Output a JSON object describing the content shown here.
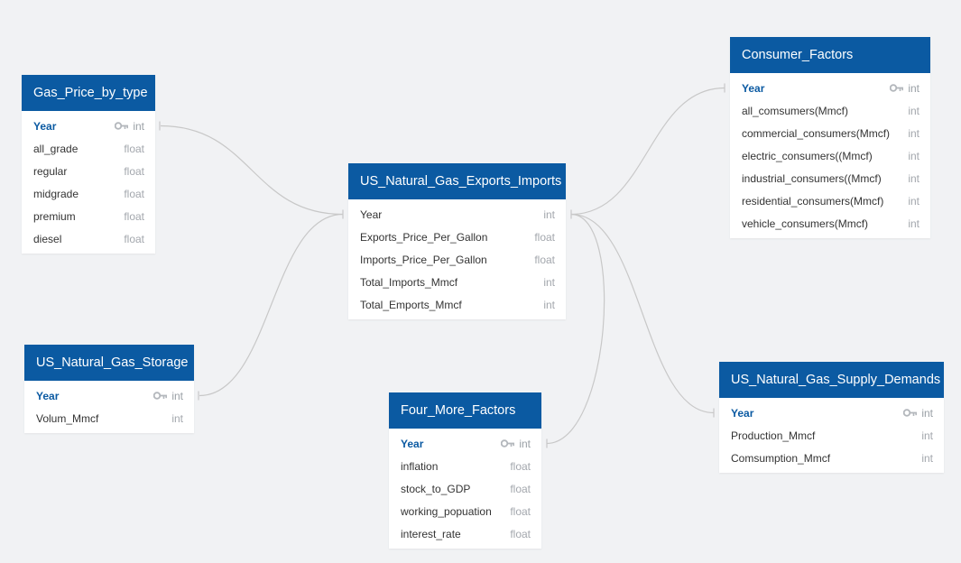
{
  "colors": {
    "background": "#f1f2f4",
    "header": "#0b5aa2",
    "pk_text": "#0b5aa2",
    "type_text": "#a3a7ad",
    "connector": "#c8c8c8"
  },
  "tables": {
    "gas_price": {
      "title": "Gas_Price_by_type",
      "columns": [
        {
          "name": "Year",
          "type": "int",
          "pk": true
        },
        {
          "name": "all_grade",
          "type": "float"
        },
        {
          "name": "regular",
          "type": "float"
        },
        {
          "name": "midgrade",
          "type": "float"
        },
        {
          "name": "premium",
          "type": "float"
        },
        {
          "name": "diesel",
          "type": "float"
        }
      ]
    },
    "storage": {
      "title": "US_Natural_Gas_Storage",
      "columns": [
        {
          "name": "Year",
          "type": "int",
          "pk": true
        },
        {
          "name": "Volum_Mmcf",
          "type": "int"
        }
      ]
    },
    "exports_imports": {
      "title": "US_Natural_Gas_Exports_Imports",
      "columns": [
        {
          "name": "Year",
          "type": "int",
          "pk": false,
          "bold": true
        },
        {
          "name": "Exports_Price_Per_Gallon",
          "type": "float"
        },
        {
          "name": "Imports_Price_Per_Gallon",
          "type": "float"
        },
        {
          "name": "Total_Imports_Mmcf",
          "type": "int"
        },
        {
          "name": "Total_Emports_Mmcf",
          "type": "int"
        }
      ]
    },
    "four_more": {
      "title": "Four_More_Factors",
      "columns": [
        {
          "name": "Year",
          "type": "int",
          "pk": true
        },
        {
          "name": "inflation",
          "type": "float"
        },
        {
          "name": "stock_to_GDP",
          "type": "float"
        },
        {
          "name": "working_popuation",
          "type": "float"
        },
        {
          "name": "interest_rate",
          "type": "float"
        }
      ]
    },
    "consumer": {
      "title": "Consumer_Factors",
      "columns": [
        {
          "name": "Year",
          "type": "int",
          "pk": true
        },
        {
          "name": "all_comsumers(Mmcf)",
          "type": "int"
        },
        {
          "name": "commercial_consumers(Mmcf)",
          "type": "int"
        },
        {
          "name": "electric_consumers((Mmcf)",
          "type": "int"
        },
        {
          "name": "industrial_consumers((Mmcf)",
          "type": "int"
        },
        {
          "name": "residential_consumers(Mmcf)",
          "type": "int"
        },
        {
          "name": "vehicle_consumers(Mmcf)",
          "type": "int"
        }
      ]
    },
    "supply_demands": {
      "title": "US_Natural_Gas_Supply_Demands",
      "columns": [
        {
          "name": "Year",
          "type": "int",
          "pk": true
        },
        {
          "name": "Production_Mmcf",
          "type": "int"
        },
        {
          "name": "Comsumption_Mmcf",
          "type": "int"
        }
      ]
    }
  },
  "relationships": [
    {
      "from": "gas_price",
      "to": "exports_imports",
      "on": "Year"
    },
    {
      "from": "storage",
      "to": "exports_imports",
      "on": "Year"
    },
    {
      "from": "exports_imports",
      "to": "consumer",
      "on": "Year"
    },
    {
      "from": "exports_imports",
      "to": "four_more",
      "on": "Year"
    },
    {
      "from": "exports_imports",
      "to": "supply_demands",
      "on": "Year"
    }
  ]
}
